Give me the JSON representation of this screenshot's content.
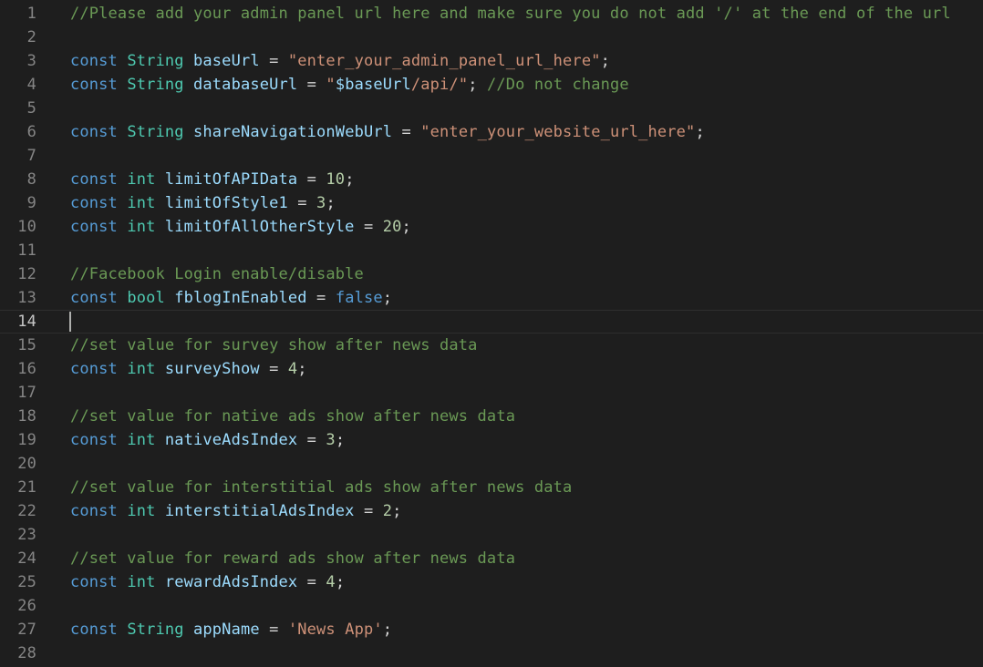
{
  "editor": {
    "current_line": 14,
    "lines": [
      {
        "num": "1",
        "tokens": [
          {
            "t": "//Please add your admin panel url here and make sure you do not add '/' at the end of the url",
            "k": "comment"
          }
        ]
      },
      {
        "num": "2",
        "tokens": []
      },
      {
        "num": "3",
        "tokens": [
          {
            "t": "const",
            "k": "keyword"
          },
          {
            "t": " ",
            "k": "op"
          },
          {
            "t": "String",
            "k": "type"
          },
          {
            "t": " ",
            "k": "op"
          },
          {
            "t": "baseUrl",
            "k": "var"
          },
          {
            "t": " = ",
            "k": "op"
          },
          {
            "t": "\"enter_your_admin_panel_url_here\"",
            "k": "string"
          },
          {
            "t": ";",
            "k": "op"
          }
        ]
      },
      {
        "num": "4",
        "tokens": [
          {
            "t": "const",
            "k": "keyword"
          },
          {
            "t": " ",
            "k": "op"
          },
          {
            "t": "String",
            "k": "type"
          },
          {
            "t": " ",
            "k": "op"
          },
          {
            "t": "databaseUrl",
            "k": "var"
          },
          {
            "t": " = ",
            "k": "op"
          },
          {
            "t": "\"",
            "k": "string"
          },
          {
            "t": "$baseUrl",
            "k": "interp"
          },
          {
            "t": "/api/\"",
            "k": "string"
          },
          {
            "t": "; ",
            "k": "op"
          },
          {
            "t": "//Do not change",
            "k": "comment"
          }
        ]
      },
      {
        "num": "5",
        "tokens": []
      },
      {
        "num": "6",
        "tokens": [
          {
            "t": "const",
            "k": "keyword"
          },
          {
            "t": " ",
            "k": "op"
          },
          {
            "t": "String",
            "k": "type"
          },
          {
            "t": " ",
            "k": "op"
          },
          {
            "t": "shareNavigationWebUrl",
            "k": "var"
          },
          {
            "t": " = ",
            "k": "op"
          },
          {
            "t": "\"enter_your_website_url_here\"",
            "k": "string"
          },
          {
            "t": ";",
            "k": "op"
          }
        ]
      },
      {
        "num": "7",
        "tokens": []
      },
      {
        "num": "8",
        "tokens": [
          {
            "t": "const",
            "k": "keyword"
          },
          {
            "t": " ",
            "k": "op"
          },
          {
            "t": "int",
            "k": "type"
          },
          {
            "t": " ",
            "k": "op"
          },
          {
            "t": "limitOfAPIData",
            "k": "var"
          },
          {
            "t": " = ",
            "k": "op"
          },
          {
            "t": "10",
            "k": "number"
          },
          {
            "t": ";",
            "k": "op"
          }
        ]
      },
      {
        "num": "9",
        "tokens": [
          {
            "t": "const",
            "k": "keyword"
          },
          {
            "t": " ",
            "k": "op"
          },
          {
            "t": "int",
            "k": "type"
          },
          {
            "t": " ",
            "k": "op"
          },
          {
            "t": "limitOfStyle1",
            "k": "var"
          },
          {
            "t": " = ",
            "k": "op"
          },
          {
            "t": "3",
            "k": "number"
          },
          {
            "t": ";",
            "k": "op"
          }
        ]
      },
      {
        "num": "10",
        "tokens": [
          {
            "t": "const",
            "k": "keyword"
          },
          {
            "t": " ",
            "k": "op"
          },
          {
            "t": "int",
            "k": "type"
          },
          {
            "t": " ",
            "k": "op"
          },
          {
            "t": "limitOfAllOtherStyle",
            "k": "var"
          },
          {
            "t": " = ",
            "k": "op"
          },
          {
            "t": "20",
            "k": "number"
          },
          {
            "t": ";",
            "k": "op"
          }
        ]
      },
      {
        "num": "11",
        "tokens": []
      },
      {
        "num": "12",
        "tokens": [
          {
            "t": "//Facebook Login enable/disable",
            "k": "comment"
          }
        ]
      },
      {
        "num": "13",
        "tokens": [
          {
            "t": "const",
            "k": "keyword"
          },
          {
            "t": " ",
            "k": "op"
          },
          {
            "t": "bool",
            "k": "type"
          },
          {
            "t": " ",
            "k": "op"
          },
          {
            "t": "fblogInEnabled",
            "k": "var"
          },
          {
            "t": " = ",
            "k": "op"
          },
          {
            "t": "false",
            "k": "keyword"
          },
          {
            "t": ";",
            "k": "op"
          }
        ]
      },
      {
        "num": "14",
        "tokens": []
      },
      {
        "num": "15",
        "tokens": [
          {
            "t": "//set value for survey show after news data",
            "k": "comment"
          }
        ]
      },
      {
        "num": "16",
        "tokens": [
          {
            "t": "const",
            "k": "keyword"
          },
          {
            "t": " ",
            "k": "op"
          },
          {
            "t": "int",
            "k": "type"
          },
          {
            "t": " ",
            "k": "op"
          },
          {
            "t": "surveyShow",
            "k": "var"
          },
          {
            "t": " = ",
            "k": "op"
          },
          {
            "t": "4",
            "k": "number"
          },
          {
            "t": ";",
            "k": "op"
          }
        ]
      },
      {
        "num": "17",
        "tokens": []
      },
      {
        "num": "18",
        "tokens": [
          {
            "t": "//set value for native ads show after news data",
            "k": "comment"
          }
        ]
      },
      {
        "num": "19",
        "tokens": [
          {
            "t": "const",
            "k": "keyword"
          },
          {
            "t": " ",
            "k": "op"
          },
          {
            "t": "int",
            "k": "type"
          },
          {
            "t": " ",
            "k": "op"
          },
          {
            "t": "nativeAdsIndex",
            "k": "var"
          },
          {
            "t": " = ",
            "k": "op"
          },
          {
            "t": "3",
            "k": "number"
          },
          {
            "t": ";",
            "k": "op"
          }
        ]
      },
      {
        "num": "20",
        "tokens": []
      },
      {
        "num": "21",
        "tokens": [
          {
            "t": "//set value for interstitial ads show after news data",
            "k": "comment"
          }
        ]
      },
      {
        "num": "22",
        "tokens": [
          {
            "t": "const",
            "k": "keyword"
          },
          {
            "t": " ",
            "k": "op"
          },
          {
            "t": "int",
            "k": "type"
          },
          {
            "t": " ",
            "k": "op"
          },
          {
            "t": "interstitialAdsIndex",
            "k": "var"
          },
          {
            "t": " = ",
            "k": "op"
          },
          {
            "t": "2",
            "k": "number"
          },
          {
            "t": ";",
            "k": "op"
          }
        ]
      },
      {
        "num": "23",
        "tokens": []
      },
      {
        "num": "24",
        "tokens": [
          {
            "t": "//set value for reward ads show after news data",
            "k": "comment"
          }
        ]
      },
      {
        "num": "25",
        "tokens": [
          {
            "t": "const",
            "k": "keyword"
          },
          {
            "t": " ",
            "k": "op"
          },
          {
            "t": "int",
            "k": "type"
          },
          {
            "t": " ",
            "k": "op"
          },
          {
            "t": "rewardAdsIndex",
            "k": "var"
          },
          {
            "t": " = ",
            "k": "op"
          },
          {
            "t": "4",
            "k": "number"
          },
          {
            "t": ";",
            "k": "op"
          }
        ]
      },
      {
        "num": "26",
        "tokens": []
      },
      {
        "num": "27",
        "tokens": [
          {
            "t": "const",
            "k": "keyword"
          },
          {
            "t": " ",
            "k": "op"
          },
          {
            "t": "String",
            "k": "type"
          },
          {
            "t": " ",
            "k": "op"
          },
          {
            "t": "appName",
            "k": "var"
          },
          {
            "t": " = ",
            "k": "op"
          },
          {
            "t": "'News App'",
            "k": "string"
          },
          {
            "t": ";",
            "k": "op"
          }
        ]
      },
      {
        "num": "28",
        "tokens": []
      }
    ]
  }
}
